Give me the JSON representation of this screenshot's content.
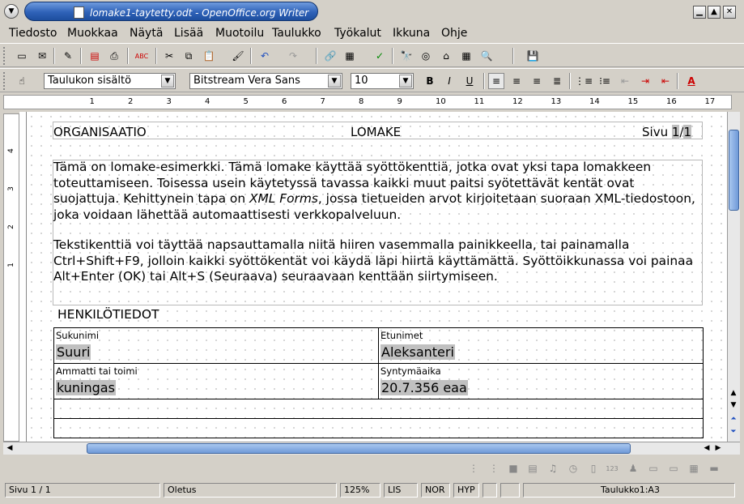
{
  "window": {
    "title": "lomake1-taytetty.odt - OpenOffice.org Writer",
    "buttons": {
      "minimize": "▁",
      "maximize": "▲",
      "close": "✕"
    }
  },
  "menubar": {
    "items": [
      "Tiedosto",
      "Muokkaa",
      "Näytä",
      "Lisää",
      "Muotoilu",
      "Taulukko",
      "Työkalut",
      "Ikkuna",
      "Ohje"
    ]
  },
  "formatting": {
    "paragraph_style": "Taulukon sisältö",
    "font_name": "Bitstream Vera Sans",
    "font_size": "10",
    "bold": "B",
    "italic": "I",
    "underline": "U",
    "font_color_letter": "A",
    "font_color": "#cc0000"
  },
  "ruler": {
    "h_ticks": [
      "1",
      "2",
      "3",
      "4",
      "5",
      "6",
      "7",
      "8",
      "9",
      "10",
      "11",
      "12",
      "13",
      "14",
      "15",
      "16",
      "17"
    ],
    "v_ticks": [
      "4",
      "3",
      "2",
      "1"
    ]
  },
  "document": {
    "header": {
      "org": "ORGANISAATIO",
      "form": "LOMAKE",
      "page_label": "Sivu ",
      "page_number": "1",
      "page_sep": "/",
      "page_total": "1"
    },
    "para1_a": "Tämä on lomake-esimerkki. Tämä lomake käyttää syöttökenttiä, jotka ovat yksi tapa lomakkeen toteuttamiseen. Toisessa usein käytetyssä tavassa kaikki muut paitsi syötettävät kentät ovat suojattuja. Kehittynein tapa on ",
    "para1_em": "XML Forms",
    "para1_b": ", jossa tietueiden arvot kirjoitetaan suoraan XML-tiedostoon, joka voidaan lähettää automaattisesti verkkopalveluun.",
    "para2": "Tekstikenttiä voi täyttää napsauttamalla niitä hiiren vasemmalla painikkeella, tai painamalla Ctrl+Shift+F9, jolloin kaikki syöttökentät voi käydä läpi hiirtä käyttämättä. Syöttöikkunassa voi painaa Alt+Enter (OK) tai Alt+S (Seuraava) seuraavaan kenttään siirtymiseen.",
    "section_title": "HENKILÖTIEDOT",
    "fields": {
      "surname_label": "Sukunimi",
      "surname_value": "Suuri",
      "firstname_label": "Etunimet",
      "firstname_value": "Aleksanteri",
      "occupation_label": "Ammatti tai toimi",
      "occupation_value": "kuningas",
      "birthdate_label": "Syntymäaika",
      "birthdate_value": "20.7.356 eaa"
    }
  },
  "statusbar": {
    "page": "Sivu 1 / 1",
    "style": "Oletus",
    "zoom": "125%",
    "insert_mode": "LIS",
    "selection_mode": "NOR",
    "hyperlink_mode": "HYP",
    "cell": "Taulukko1:A3"
  },
  "icons": {
    "toolbar1": [
      "document-icon",
      "mail-icon",
      "edit-file-icon",
      "export-pdf-icon",
      "print-icon",
      "page-preview-icon",
      "spellcheck-icon",
      "autospellcheck-icon",
      "cut-icon",
      "copy-icon",
      "paste-icon",
      "format-paintbrush-icon",
      "undo-icon",
      "redo-icon",
      "hyperlink-icon",
      "table-icon",
      "draw-functions-icon",
      "find-replace-icon",
      "navigator-icon",
      "gallery-icon",
      "data-sources-icon",
      "zoom-icon",
      "help-icon",
      "save-icon"
    ]
  }
}
